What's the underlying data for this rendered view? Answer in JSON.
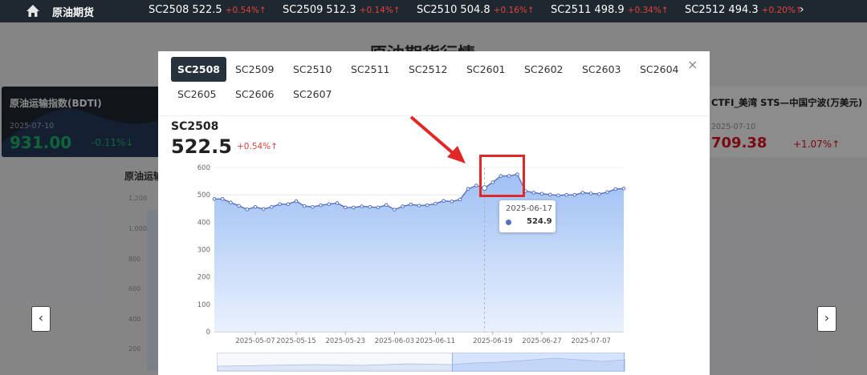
{
  "topbar": {
    "brand": "原油期货",
    "tickers": [
      {
        "code": "SC2508",
        "price": "522.5",
        "chg": "+0.54%",
        "arrow": "↑"
      },
      {
        "code": "SC2509",
        "price": "512.3",
        "chg": "+0.14%",
        "arrow": "↑"
      },
      {
        "code": "SC2510",
        "price": "504.8",
        "chg": "+0.16%",
        "arrow": "↑"
      },
      {
        "code": "SC2511",
        "price": "498.9",
        "chg": "+0.34%",
        "arrow": "↑"
      },
      {
        "code": "SC2512",
        "price": "494.3",
        "chg": "+0.20%",
        "arrow": "↑"
      }
    ],
    "next": "›"
  },
  "background": {
    "title": "原油期货行情",
    "left_card": {
      "title": "原油运输指数(BDTI)",
      "date": "2025-07-10",
      "value": "931.00",
      "change": "-0.11%↓"
    },
    "right_card": {
      "title": "CTFI_美湾 STS—中国宁波(万美元)",
      "date": "2025-07-10",
      "value": "709.38",
      "change": "+1.07%↑"
    },
    "subtitle": "原油运输",
    "axis": [
      "1,200",
      "1,000",
      "800",
      "600",
      "400",
      "200"
    ],
    "prev": "‹",
    "next": "›"
  },
  "modal": {
    "tabs": [
      "SC2508",
      "SC2509",
      "SC2510",
      "SC2511",
      "SC2512",
      "SC2601",
      "SC2602",
      "SC2603",
      "SC2604",
      "SC2605",
      "SC2606",
      "SC2607"
    ],
    "active_tab": 0,
    "close": "×",
    "code": "SC2508",
    "price": "522.5",
    "change": "+0.54%↑"
  },
  "tooltip": {
    "date": "2025-06-17",
    "value": "524.9"
  },
  "colors": {
    "line": "#5470c6",
    "area_top": "#8fb6f2",
    "area_bottom": "#e8f0fd",
    "up": "#e0443c",
    "down": "#1fb46a",
    "highlight": "#e02828"
  },
  "chart_data": {
    "type": "area",
    "ylim": [
      0,
      600
    ],
    "yticks": [
      0,
      100,
      200,
      300,
      400,
      500,
      600
    ],
    "xticks": [
      "2025-05-07",
      "2025-05-15",
      "2025-05-23",
      "2025-06-03",
      "2025-06-11",
      "2025-06-19",
      "2025-06-27",
      "2025-07-07"
    ],
    "x_tick_index": [
      5,
      10,
      16,
      22,
      27,
      34,
      40,
      46
    ],
    "series": [
      {
        "values": [
          485,
          485,
          472,
          460,
          447,
          456,
          448,
          456,
          466,
          466,
          477,
          459,
          456,
          462,
          466,
          470,
          454,
          454,
          458,
          456,
          454,
          463,
          446,
          458,
          465,
          461,
          462,
          468,
          478,
          476,
          483,
          522,
          534,
          525,
          546,
          569,
          569,
          575,
          514,
          508,
          504,
          501,
          498,
          500,
          500,
          508,
          505,
          503,
          510,
          521,
          523
        ]
      }
    ],
    "highlight_index": 33,
    "grid": true
  }
}
